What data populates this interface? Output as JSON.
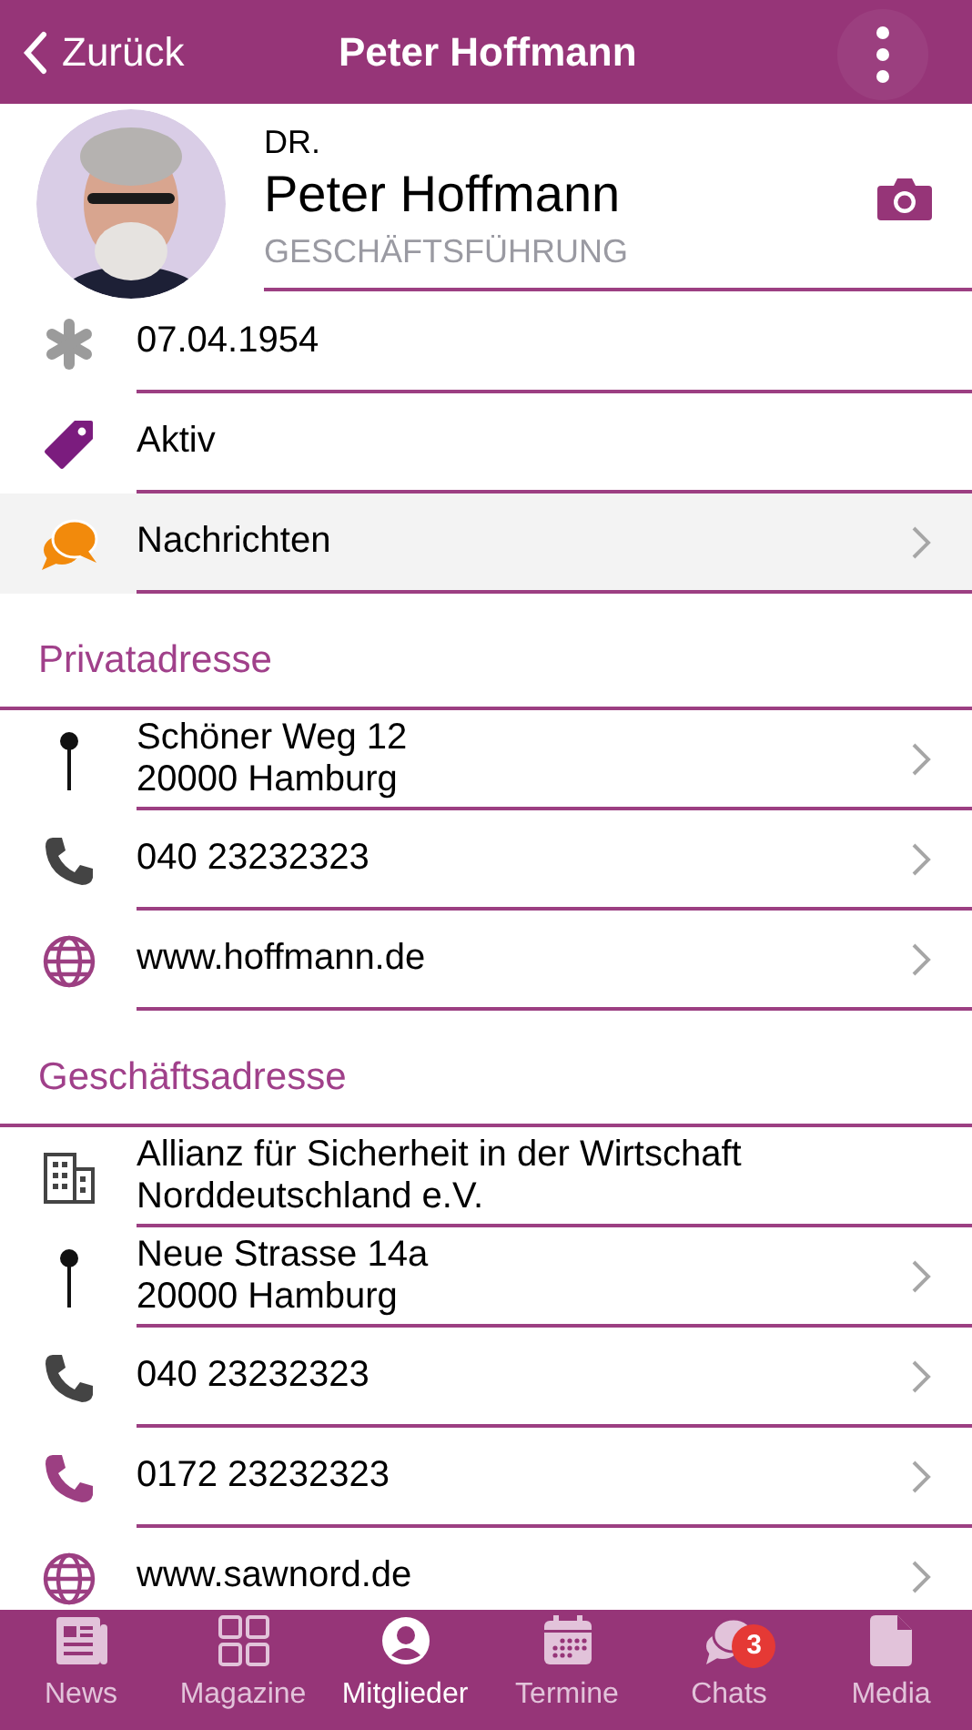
{
  "header": {
    "back": "Zurück",
    "title": "Peter Hoffmann"
  },
  "profile": {
    "prefix": "DR.",
    "name": "Peter Hoffmann",
    "position": "GESCHÄFTSFÜHRUNG"
  },
  "sections": [
    {
      "rows": [
        {
          "kind": "birthday",
          "lines": [
            "07.04.1954"
          ],
          "navigable": false,
          "highlighted": false
        },
        {
          "kind": "status",
          "lines": [
            "Aktiv"
          ],
          "navigable": false,
          "highlighted": false
        },
        {
          "kind": "messages",
          "lines": [
            "Nachrichten"
          ],
          "navigable": true,
          "highlighted": true
        }
      ]
    },
    {
      "title": "Privatadresse",
      "rows": [
        {
          "kind": "address",
          "lines": [
            "Schöner Weg 12",
            "20000 Hamburg"
          ],
          "navigable": true,
          "highlighted": false
        },
        {
          "kind": "phone",
          "lines": [
            "040 23232323"
          ],
          "navigable": true,
          "highlighted": false
        },
        {
          "kind": "web",
          "lines": [
            "www.hoffmann.de"
          ],
          "navigable": true,
          "highlighted": false
        }
      ]
    },
    {
      "title": "Geschäftsadresse",
      "rows": [
        {
          "kind": "company",
          "lines": [
            "Allianz für Sicherheit in der Wirtschaft",
            "Norddeutschland e.V."
          ],
          "navigable": false,
          "highlighted": false
        },
        {
          "kind": "address",
          "lines": [
            "Neue Strasse 14a",
            "20000 Hamburg"
          ],
          "navigable": true,
          "highlighted": false
        },
        {
          "kind": "phone",
          "lines": [
            "040 23232323"
          ],
          "navigable": true,
          "highlighted": false
        },
        {
          "kind": "mobile",
          "lines": [
            "0172 23232323"
          ],
          "navigable": true,
          "highlighted": false
        },
        {
          "kind": "web",
          "lines": [
            "www.sawnord.de"
          ],
          "navigable": true,
          "highlighted": false
        }
      ]
    }
  ],
  "tabs": [
    {
      "kind": "news",
      "label": "News",
      "selected": false
    },
    {
      "kind": "magazine",
      "label": "Magazine",
      "selected": false
    },
    {
      "kind": "members",
      "label": "Mitglieder",
      "selected": true
    },
    {
      "kind": "events",
      "label": "Termine",
      "selected": false
    },
    {
      "kind": "chats",
      "label": "Chats",
      "selected": false,
      "badge": "3"
    },
    {
      "kind": "media",
      "label": "Media",
      "selected": false
    }
  ]
}
